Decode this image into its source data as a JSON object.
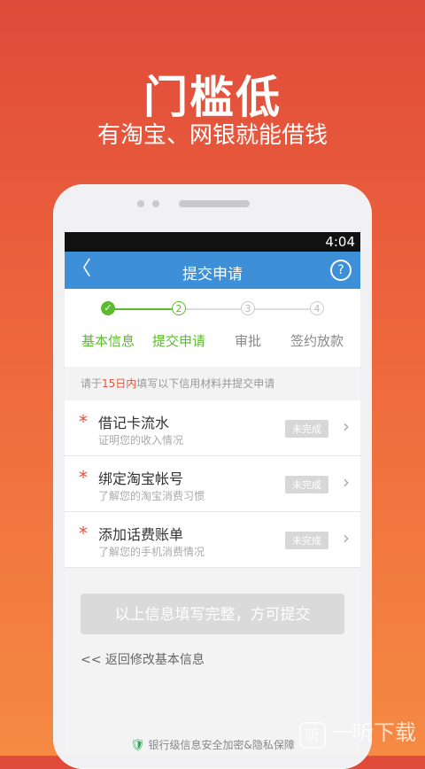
{
  "hero": {
    "title": "门槛低",
    "subtitle": "有淘宝、网银就能借钱"
  },
  "status_bar": {
    "time": "4:04"
  },
  "navbar": {
    "back": "〈",
    "title": "提交申请",
    "help": "?"
  },
  "steps": [
    {
      "label": "基本信息",
      "num": "✓",
      "state": "done"
    },
    {
      "label": "提交申请",
      "num": "2",
      "state": "current"
    },
    {
      "label": "审批",
      "num": "3",
      "state": "pending"
    },
    {
      "label": "签约放款",
      "num": "4",
      "state": "pending"
    }
  ],
  "hint": {
    "prefix": "请于",
    "highlight": "15日内",
    "suffix": "填写以下信用材料并提交申请"
  },
  "items": [
    {
      "star": "*",
      "title": "借记卡流水",
      "subtitle": "证明您的收入情况",
      "status": "未完成",
      "chevron": "›"
    },
    {
      "star": "*",
      "title": "绑定淘宝帐号",
      "subtitle": "了解您的淘宝消费习惯",
      "status": "未完成",
      "chevron": "›"
    },
    {
      "star": "*",
      "title": "添加话费账单",
      "subtitle": "了解您的手机消费情况",
      "status": "未完成",
      "chevron": "›"
    }
  ],
  "submit_button": "以上信息填写完整，方可提交",
  "back_link": "<< 返回修改基本信息",
  "footer": "银行级信息安全加密&隐私保障",
  "watermark": {
    "logo": "听",
    "text": "一听下载"
  },
  "colors": {
    "accent_blue": "#3d8fd8",
    "green": "#5cbb2e",
    "red": "#e5523b"
  }
}
